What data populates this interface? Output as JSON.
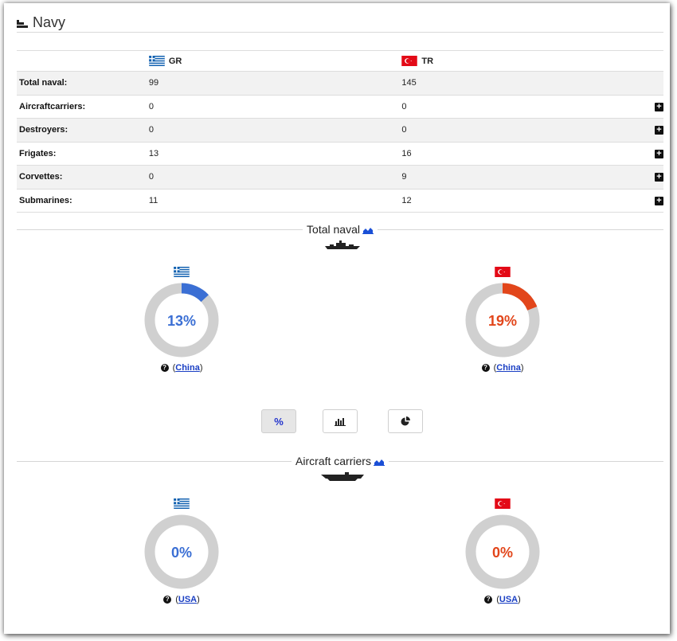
{
  "header": {
    "title": "Navy",
    "icon": "ship-icon"
  },
  "table": {
    "countries": [
      {
        "code": "GR",
        "flag": "greece-flag"
      },
      {
        "code": "TR",
        "flag": "turkey-flag"
      }
    ],
    "rows": [
      {
        "label": "Total naval:",
        "gr": "99",
        "tr": "145",
        "expandable": false
      },
      {
        "label": "Aircraftcarriers:",
        "gr": "0",
        "tr": "0",
        "expandable": true
      },
      {
        "label": "Destroyers:",
        "gr": "0",
        "tr": "0",
        "expandable": true
      },
      {
        "label": "Frigates:",
        "gr": "13",
        "tr": "16",
        "expandable": true
      },
      {
        "label": "Corvettes:",
        "gr": "0",
        "tr": "9",
        "expandable": true
      },
      {
        "label": "Submarines:",
        "gr": "11",
        "tr": "12",
        "expandable": true
      }
    ]
  },
  "sections": [
    {
      "title": "Total naval",
      "gauges": [
        {
          "country": "GR",
          "label": "13%",
          "fraction": 0.13,
          "color": "#3b6fd4",
          "source_open": "(",
          "source": "China",
          "source_close": ")"
        },
        {
          "country": "TR",
          "label": "19%",
          "fraction": 0.19,
          "color": "#e2461b",
          "source_open": "(",
          "source": "China",
          "source_close": ")"
        }
      ]
    },
    {
      "title": "Aircraft carriers",
      "gauges": [
        {
          "country": "GR",
          "label": "0%",
          "fraction": 0,
          "color": "#3b6fd4",
          "source_open": "(",
          "source": "USA",
          "source_close": ")"
        },
        {
          "country": "TR",
          "label": "0%",
          "fraction": 0,
          "color": "#e2461b",
          "source_open": "(",
          "source": "USA",
          "source_close": ")"
        }
      ]
    }
  ],
  "view_buttons": [
    {
      "name": "percent",
      "label": "%",
      "icon": "percent-icon",
      "active": true
    },
    {
      "name": "bar",
      "label": "",
      "icon": "bar-chart-icon",
      "active": false
    },
    {
      "name": "pie",
      "label": "",
      "icon": "pie-chart-icon",
      "active": false
    }
  ],
  "colors": {
    "gr": "#3b6fd4",
    "tr": "#e2461b",
    "ring_bg": "#d0d0d0"
  }
}
